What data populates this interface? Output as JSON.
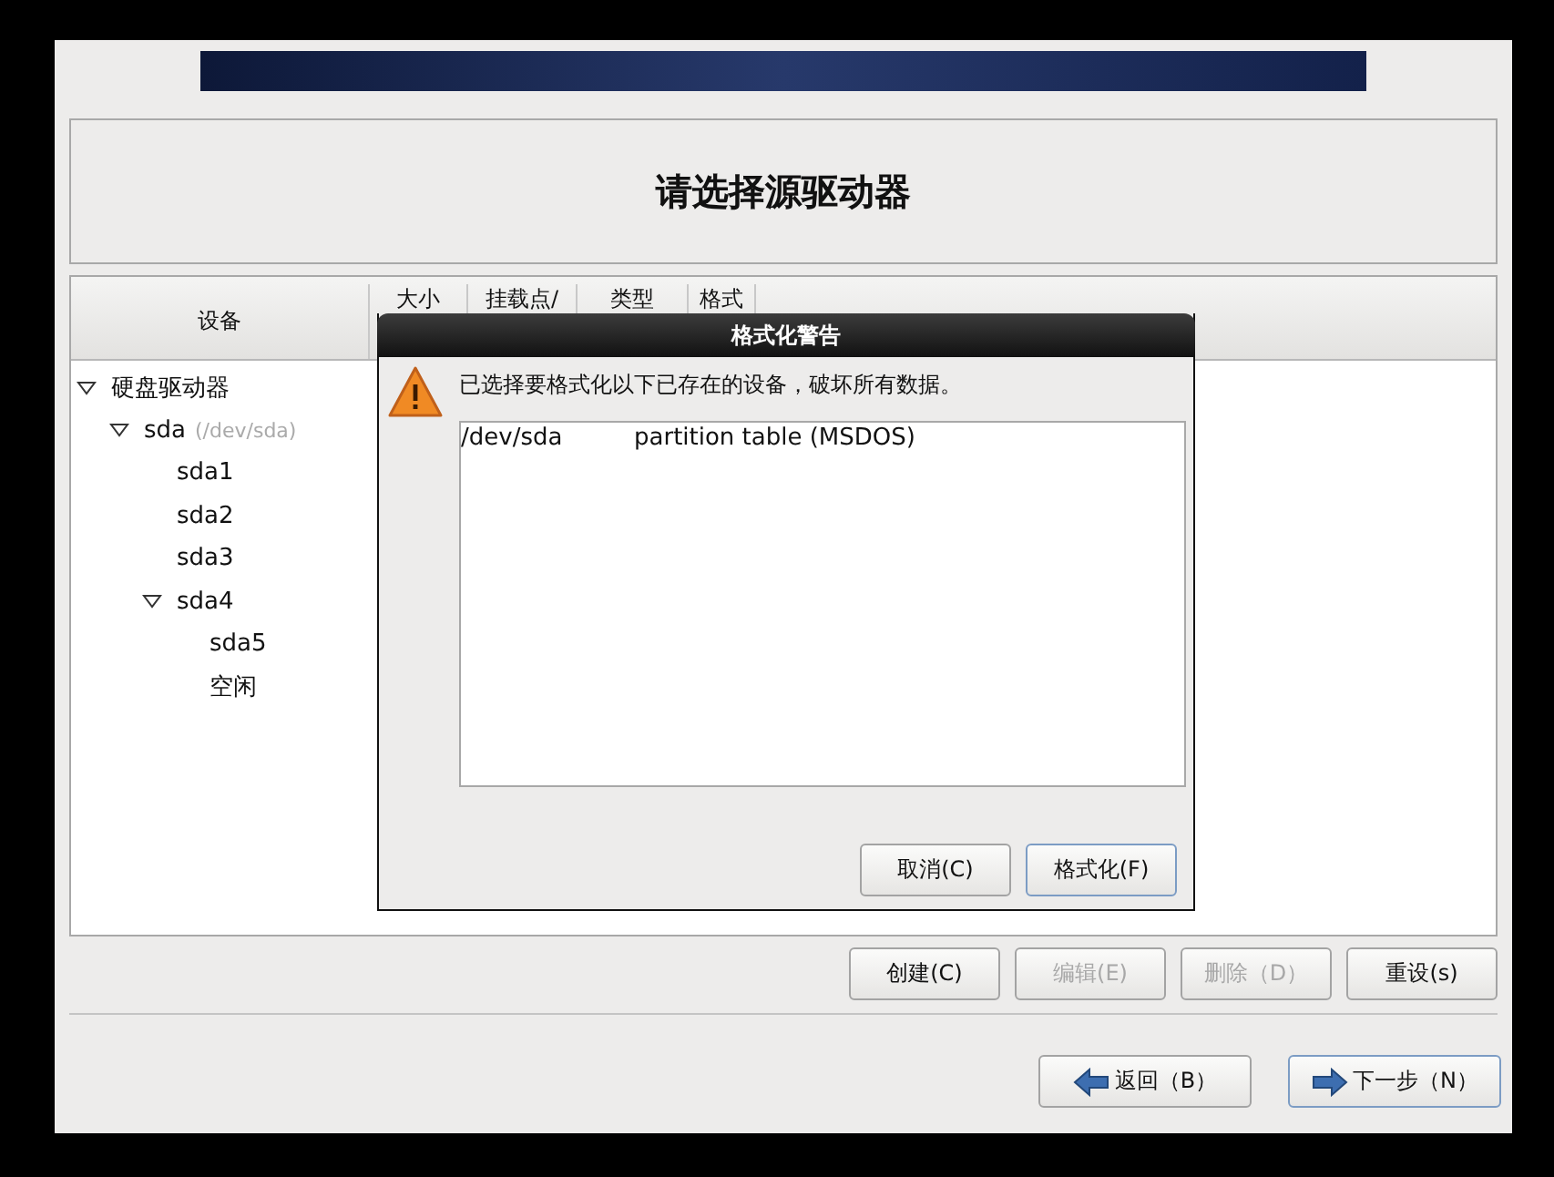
{
  "title": "请选择源驱动器",
  "table": {
    "columns": [
      "设备",
      "大小",
      "挂载点/",
      "类型",
      "格式"
    ],
    "tree": [
      {
        "label": "硬盘驱动器",
        "expanded": true,
        "children": [
          {
            "label": "sda",
            "detail": "(/dev/sda)",
            "expanded": true,
            "children": [
              {
                "label": "sda1"
              },
              {
                "label": "sda2"
              },
              {
                "label": "sda3"
              },
              {
                "label": "sda4",
                "expanded": true,
                "children": [
                  {
                    "label": "sda5"
                  },
                  {
                    "label": "空闲"
                  }
                ]
              }
            ]
          }
        ]
      }
    ]
  },
  "dialog": {
    "title": "格式化警告",
    "message": "已选择要格式化以下已存在的设备，破坏所有数据。",
    "devices": [
      {
        "device": "/dev/sda",
        "description": "partition table (MSDOS)"
      }
    ],
    "buttons": [
      {
        "label": "取消(C)",
        "focused": false
      },
      {
        "label": "格式化(F)",
        "focused": true
      }
    ]
  },
  "actions": [
    {
      "label": "创建(C)",
      "disabled": false
    },
    {
      "label": "编辑(E)",
      "disabled": true
    },
    {
      "label": "删除（D）",
      "disabled": true
    },
    {
      "label": "重设(s)",
      "disabled": false
    }
  ],
  "navigation": [
    {
      "kind": "back",
      "label": "返回（B）",
      "focused": false
    },
    {
      "kind": "next",
      "label": "下一步（N）",
      "focused": true
    }
  ]
}
